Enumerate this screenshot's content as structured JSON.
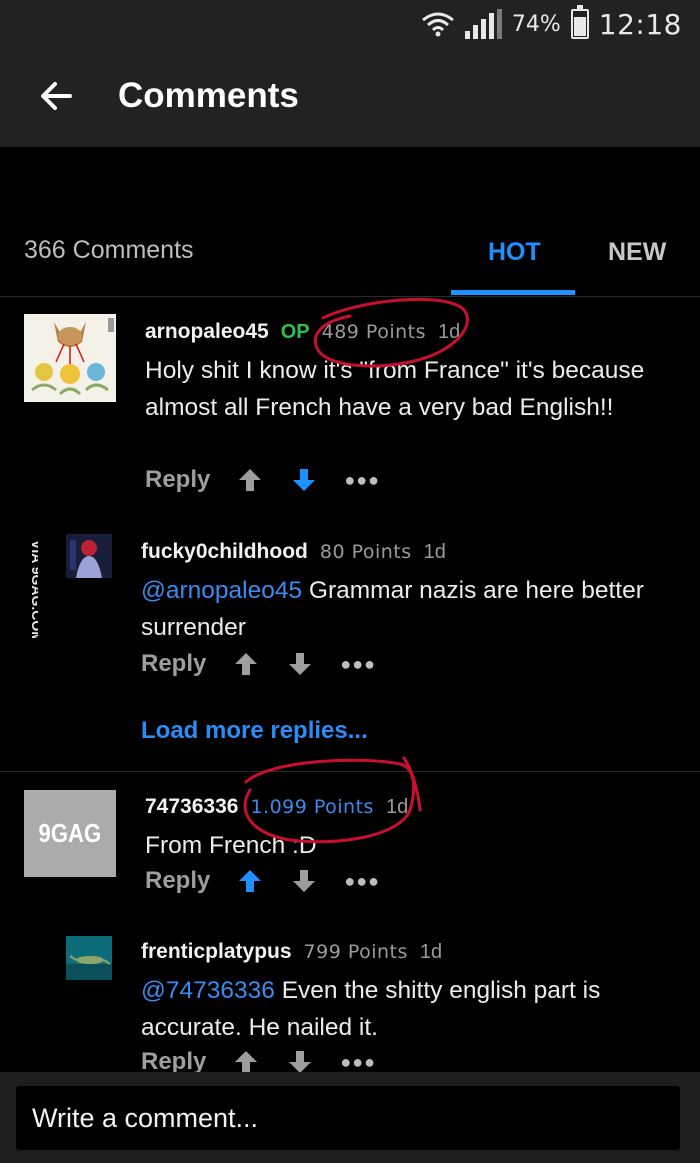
{
  "status_bar": {
    "battery": "74%",
    "battery_level": 0.74,
    "time": "12:18"
  },
  "app_bar": {
    "title": "Comments",
    "back_icon": "arrow-left-icon"
  },
  "tabs_row": {
    "count_label": "366 Comments",
    "tabs": [
      {
        "label": "HOT",
        "active": true
      },
      {
        "label": "NEW",
        "active": false
      }
    ]
  },
  "comments": [
    {
      "username": "arnopaleo45",
      "op_badge": "OP",
      "points": "489 Points",
      "age": "1d",
      "text": "Holy shit I know it's \"from France\" it's because almost all French have a very bad English!!",
      "reply_label": "Reply",
      "vote": "down"
    },
    {
      "username": "fucky0childhood",
      "points": "80 Points",
      "age": "1d",
      "mention": "@arnopaleo45",
      "text": " Grammar nazis are here better surrender",
      "reply_label": "Reply",
      "vote": "none"
    },
    {
      "username": "74736336",
      "points": "1.099 Points",
      "age": "1d",
      "text": "From French :D",
      "avatar_text": "9GAG",
      "reply_label": "Reply",
      "vote": "up"
    },
    {
      "username": "frenticplatypus",
      "points": "799 Points",
      "age": "1d",
      "mention": "@74736336",
      "text": " Even the shitty english part is accurate. He nailed it.",
      "reply_label": "Reply",
      "vote": "none"
    }
  ],
  "load_more": "Load more replies...",
  "watermark": "VIA 9GAG.COM",
  "composer": {
    "placeholder": "Write a comment..."
  },
  "colors": {
    "accent": "#1e90ff",
    "op_green": "#2fbf4f",
    "annotation_red": "#c8102e",
    "background": "#000000",
    "bar": "#222222"
  }
}
